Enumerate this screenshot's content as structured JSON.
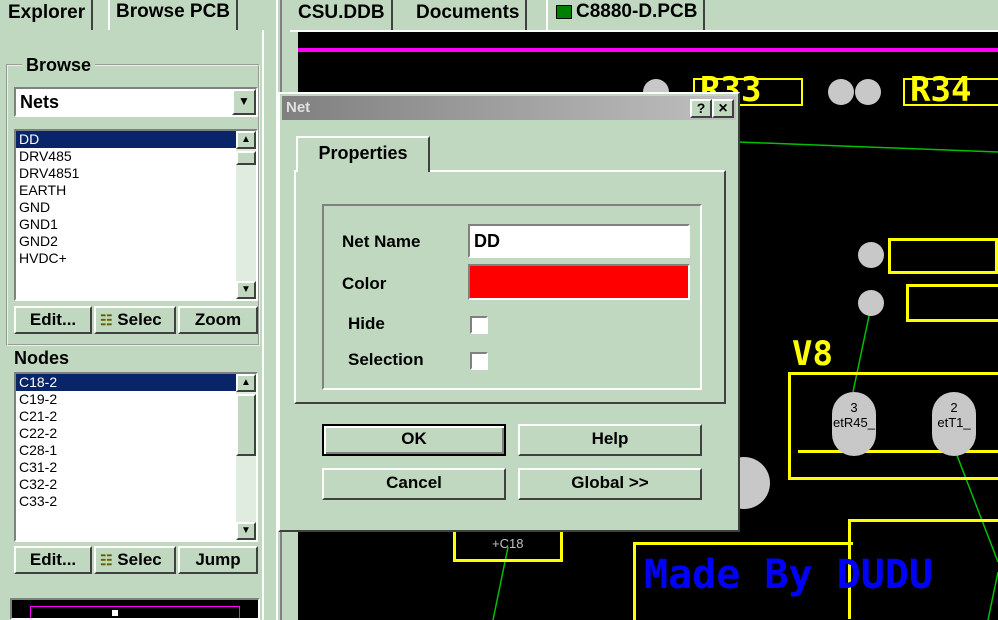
{
  "left_tabs": [
    "Explorer",
    "Browse PCB"
  ],
  "doc_tabs": [
    "CSU.DDB",
    "Documents",
    "C8880-D.PCB"
  ],
  "browse": {
    "group_label": "Browse",
    "selected_type": "Nets",
    "nets": [
      "DD",
      "DRV485",
      "DRV4851",
      "EARTH",
      "GND",
      "GND1",
      "GND2",
      "HVDC+"
    ],
    "buttons": [
      "Edit...",
      "Selec",
      "Zoom"
    ]
  },
  "nodes": {
    "label": "Nodes",
    "items": [
      "C18-2",
      "C19-2",
      "C21-2",
      "C22-2",
      "C28-1",
      "C31-2",
      "C32-2",
      "C33-2"
    ],
    "buttons": [
      "Edit...",
      "Selec",
      "Jump"
    ]
  },
  "dialog": {
    "title": "Net",
    "help_btn": "?",
    "close_btn": "×",
    "tab": "Properties",
    "net_name_label": "Net Name",
    "net_name_value": "DD",
    "color_label": "Color",
    "color_value": "#ff0000",
    "hide_label": "Hide",
    "selection_label": "Selection",
    "ok": "OK",
    "help": "Help",
    "cancel": "Cancel",
    "global": "Global >>"
  },
  "pcb": {
    "labels": [
      "R33",
      "R34",
      "V8",
      "+C18"
    ],
    "pad_labels": [
      {
        "num": "3",
        "net": "etR45_"
      },
      {
        "num": "2",
        "net": "etT1_"
      }
    ],
    "watermark": "Made By DUDU"
  }
}
